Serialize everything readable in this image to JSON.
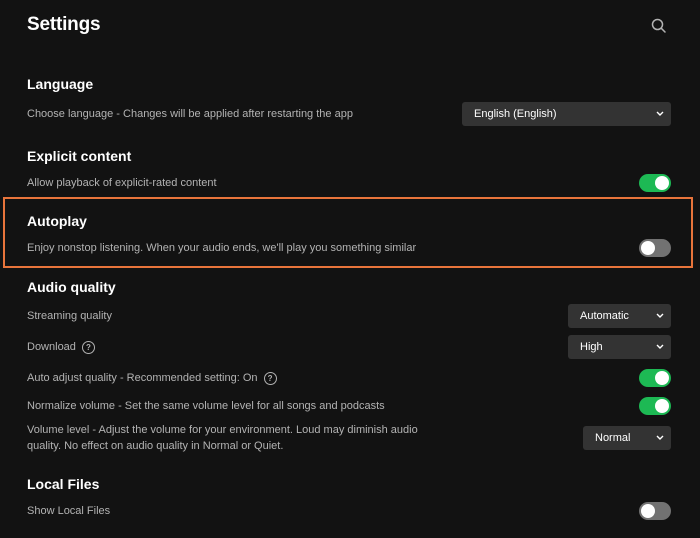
{
  "page": {
    "title": "Settings"
  },
  "colors": {
    "accent": "#1db954",
    "highlight": "#e8743b",
    "background": "#121212"
  },
  "icons": {
    "search": "search-icon",
    "help": "help-circle-icon",
    "chevron": "chevron-down-icon"
  },
  "language": {
    "title": "Language",
    "label": "Choose language - Changes will be applied after restarting the app",
    "selected": "English (English)"
  },
  "explicit": {
    "title": "Explicit content",
    "label": "Allow playback of explicit-rated content",
    "enabled": true
  },
  "autoplay": {
    "title": "Autoplay",
    "label": "Enjoy nonstop listening. When your audio ends, we'll play you something similar",
    "enabled": false
  },
  "audio_quality": {
    "title": "Audio quality",
    "streaming": {
      "label": "Streaming quality",
      "selected": "Automatic"
    },
    "download": {
      "label": "Download",
      "help": "?",
      "selected": "High"
    },
    "auto_adjust": {
      "label": "Auto adjust quality - Recommended setting: On",
      "help": "?",
      "enabled": true
    },
    "normalize": {
      "label": "Normalize volume - Set the same volume level for all songs and podcasts",
      "enabled": true
    },
    "volume_level": {
      "label": "Volume level - Adjust the volume for your environment. Loud may diminish audio quality. No effect on audio quality in Normal or Quiet.",
      "selected": "Normal"
    }
  },
  "local_files": {
    "title": "Local Files",
    "show": {
      "label": "Show Local Files",
      "enabled": false
    }
  }
}
